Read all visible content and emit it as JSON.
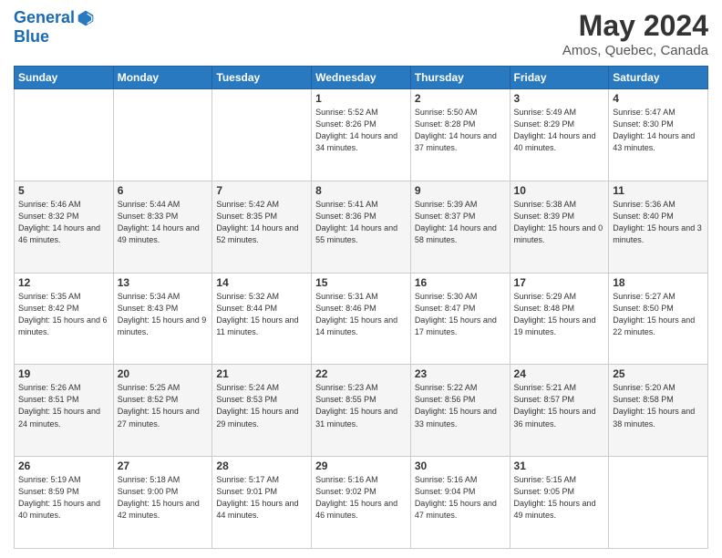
{
  "header": {
    "logo_line1": "General",
    "logo_line2": "Blue",
    "title": "May 2024",
    "subtitle": "Amos, Quebec, Canada"
  },
  "weekdays": [
    "Sunday",
    "Monday",
    "Tuesday",
    "Wednesday",
    "Thursday",
    "Friday",
    "Saturday"
  ],
  "weeks": [
    [
      {
        "day": "",
        "sunrise": "",
        "sunset": "",
        "daylight": ""
      },
      {
        "day": "",
        "sunrise": "",
        "sunset": "",
        "daylight": ""
      },
      {
        "day": "",
        "sunrise": "",
        "sunset": "",
        "daylight": ""
      },
      {
        "day": "1",
        "sunrise": "Sunrise: 5:52 AM",
        "sunset": "Sunset: 8:26 PM",
        "daylight": "Daylight: 14 hours and 34 minutes."
      },
      {
        "day": "2",
        "sunrise": "Sunrise: 5:50 AM",
        "sunset": "Sunset: 8:28 PM",
        "daylight": "Daylight: 14 hours and 37 minutes."
      },
      {
        "day": "3",
        "sunrise": "Sunrise: 5:49 AM",
        "sunset": "Sunset: 8:29 PM",
        "daylight": "Daylight: 14 hours and 40 minutes."
      },
      {
        "day": "4",
        "sunrise": "Sunrise: 5:47 AM",
        "sunset": "Sunset: 8:30 PM",
        "daylight": "Daylight: 14 hours and 43 minutes."
      }
    ],
    [
      {
        "day": "5",
        "sunrise": "Sunrise: 5:46 AM",
        "sunset": "Sunset: 8:32 PM",
        "daylight": "Daylight: 14 hours and 46 minutes."
      },
      {
        "day": "6",
        "sunrise": "Sunrise: 5:44 AM",
        "sunset": "Sunset: 8:33 PM",
        "daylight": "Daylight: 14 hours and 49 minutes."
      },
      {
        "day": "7",
        "sunrise": "Sunrise: 5:42 AM",
        "sunset": "Sunset: 8:35 PM",
        "daylight": "Daylight: 14 hours and 52 minutes."
      },
      {
        "day": "8",
        "sunrise": "Sunrise: 5:41 AM",
        "sunset": "Sunset: 8:36 PM",
        "daylight": "Daylight: 14 hours and 55 minutes."
      },
      {
        "day": "9",
        "sunrise": "Sunrise: 5:39 AM",
        "sunset": "Sunset: 8:37 PM",
        "daylight": "Daylight: 14 hours and 58 minutes."
      },
      {
        "day": "10",
        "sunrise": "Sunrise: 5:38 AM",
        "sunset": "Sunset: 8:39 PM",
        "daylight": "Daylight: 15 hours and 0 minutes."
      },
      {
        "day": "11",
        "sunrise": "Sunrise: 5:36 AM",
        "sunset": "Sunset: 8:40 PM",
        "daylight": "Daylight: 15 hours and 3 minutes."
      }
    ],
    [
      {
        "day": "12",
        "sunrise": "Sunrise: 5:35 AM",
        "sunset": "Sunset: 8:42 PM",
        "daylight": "Daylight: 15 hours and 6 minutes."
      },
      {
        "day": "13",
        "sunrise": "Sunrise: 5:34 AM",
        "sunset": "Sunset: 8:43 PM",
        "daylight": "Daylight: 15 hours and 9 minutes."
      },
      {
        "day": "14",
        "sunrise": "Sunrise: 5:32 AM",
        "sunset": "Sunset: 8:44 PM",
        "daylight": "Daylight: 15 hours and 11 minutes."
      },
      {
        "day": "15",
        "sunrise": "Sunrise: 5:31 AM",
        "sunset": "Sunset: 8:46 PM",
        "daylight": "Daylight: 15 hours and 14 minutes."
      },
      {
        "day": "16",
        "sunrise": "Sunrise: 5:30 AM",
        "sunset": "Sunset: 8:47 PM",
        "daylight": "Daylight: 15 hours and 17 minutes."
      },
      {
        "day": "17",
        "sunrise": "Sunrise: 5:29 AM",
        "sunset": "Sunset: 8:48 PM",
        "daylight": "Daylight: 15 hours and 19 minutes."
      },
      {
        "day": "18",
        "sunrise": "Sunrise: 5:27 AM",
        "sunset": "Sunset: 8:50 PM",
        "daylight": "Daylight: 15 hours and 22 minutes."
      }
    ],
    [
      {
        "day": "19",
        "sunrise": "Sunrise: 5:26 AM",
        "sunset": "Sunset: 8:51 PM",
        "daylight": "Daylight: 15 hours and 24 minutes."
      },
      {
        "day": "20",
        "sunrise": "Sunrise: 5:25 AM",
        "sunset": "Sunset: 8:52 PM",
        "daylight": "Daylight: 15 hours and 27 minutes."
      },
      {
        "day": "21",
        "sunrise": "Sunrise: 5:24 AM",
        "sunset": "Sunset: 8:53 PM",
        "daylight": "Daylight: 15 hours and 29 minutes."
      },
      {
        "day": "22",
        "sunrise": "Sunrise: 5:23 AM",
        "sunset": "Sunset: 8:55 PM",
        "daylight": "Daylight: 15 hours and 31 minutes."
      },
      {
        "day": "23",
        "sunrise": "Sunrise: 5:22 AM",
        "sunset": "Sunset: 8:56 PM",
        "daylight": "Daylight: 15 hours and 33 minutes."
      },
      {
        "day": "24",
        "sunrise": "Sunrise: 5:21 AM",
        "sunset": "Sunset: 8:57 PM",
        "daylight": "Daylight: 15 hours and 36 minutes."
      },
      {
        "day": "25",
        "sunrise": "Sunrise: 5:20 AM",
        "sunset": "Sunset: 8:58 PM",
        "daylight": "Daylight: 15 hours and 38 minutes."
      }
    ],
    [
      {
        "day": "26",
        "sunrise": "Sunrise: 5:19 AM",
        "sunset": "Sunset: 8:59 PM",
        "daylight": "Daylight: 15 hours and 40 minutes."
      },
      {
        "day": "27",
        "sunrise": "Sunrise: 5:18 AM",
        "sunset": "Sunset: 9:00 PM",
        "daylight": "Daylight: 15 hours and 42 minutes."
      },
      {
        "day": "28",
        "sunrise": "Sunrise: 5:17 AM",
        "sunset": "Sunset: 9:01 PM",
        "daylight": "Daylight: 15 hours and 44 minutes."
      },
      {
        "day": "29",
        "sunrise": "Sunrise: 5:16 AM",
        "sunset": "Sunset: 9:02 PM",
        "daylight": "Daylight: 15 hours and 46 minutes."
      },
      {
        "day": "30",
        "sunrise": "Sunrise: 5:16 AM",
        "sunset": "Sunset: 9:04 PM",
        "daylight": "Daylight: 15 hours and 47 minutes."
      },
      {
        "day": "31",
        "sunrise": "Sunrise: 5:15 AM",
        "sunset": "Sunset: 9:05 PM",
        "daylight": "Daylight: 15 hours and 49 minutes."
      },
      {
        "day": "",
        "sunrise": "",
        "sunset": "",
        "daylight": ""
      }
    ]
  ]
}
